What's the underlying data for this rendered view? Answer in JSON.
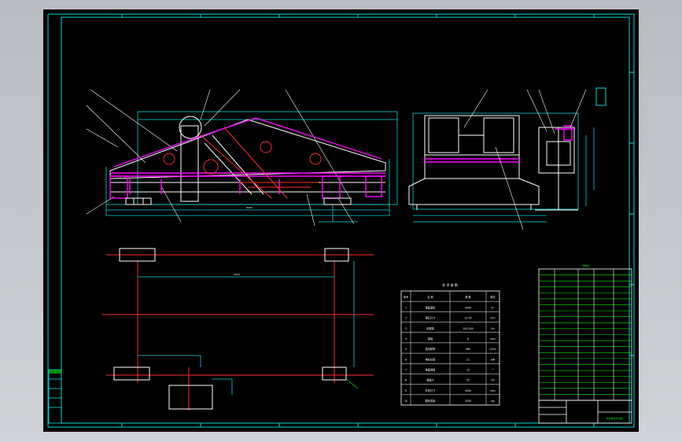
{
  "drawing": {
    "title_block_label": "某某振动筛总图",
    "spec_table_title": "技 术 参 数",
    "spec_headers": [
      "序号",
      "名 称",
      "参 数",
      "单位"
    ],
    "spec_rows": [
      [
        "1",
        "筛面面积",
        "2000",
        "m²"
      ],
      [
        "2",
        "筛孔尺寸",
        "13-50",
        "mm"
      ],
      [
        "3",
        "处理量",
        "100-200",
        "t/h"
      ],
      [
        "4",
        "振幅",
        "8",
        "mm"
      ],
      [
        "5",
        "振动频率",
        "960",
        "r/min"
      ],
      [
        "6",
        "电机功率",
        "11",
        "kW"
      ],
      [
        "7",
        "筛面倾角",
        "15",
        "°"
      ],
      [
        "8",
        "激振力",
        "55",
        "kN"
      ],
      [
        "9",
        "外形尺寸",
        "5000",
        "mm"
      ],
      [
        "10",
        "整机重量",
        "4250",
        "kg"
      ]
    ],
    "parts_list_title": "明细表",
    "dimension_overall": "5000",
    "dimension_plan": "4000"
  },
  "colors": {
    "sheet": "#000000",
    "frame": "#00d7d7",
    "outline": "#ffffff",
    "structure": "#ff00ff",
    "centerline": "#ff2a2a",
    "annotation": "#00e600"
  }
}
